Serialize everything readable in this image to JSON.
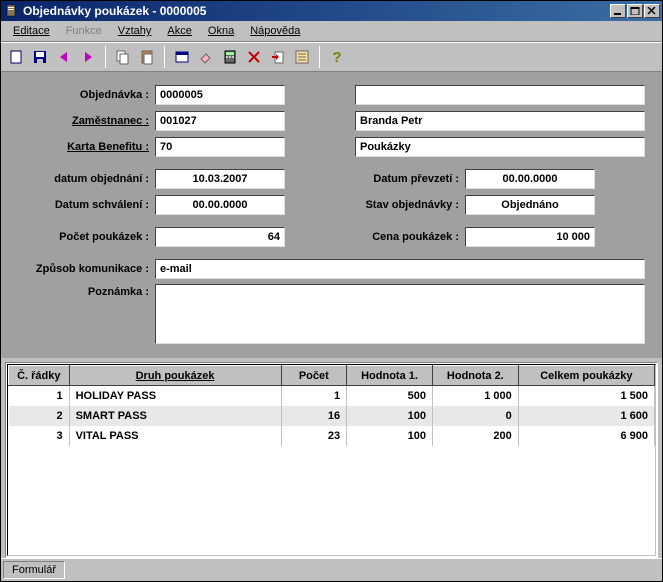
{
  "window": {
    "title": "Objednávky poukázek - 0000005"
  },
  "menu": {
    "editace": "Editace",
    "funkce": "Funkce",
    "vztahy": "Vztahy",
    "akce": "Akce",
    "okna": "Okna",
    "napoveda": "Nápověda"
  },
  "form": {
    "labels": {
      "objednavka": "Objednávka :",
      "zamestnanec": "Zaměstnanec :",
      "karta_benefitu": "Karta Benefitu :",
      "datum_objednani": "datum objednání :",
      "datum_prevzeti": "Datum převzetí :",
      "datum_schvaleni": "Datum schválení :",
      "stav_objednavky": "Stav objednávky :",
      "pocet_poukazek": "Počet poukázek :",
      "cena_poukazek": "Cena poukázek :",
      "zpusob_komunikace": "Způsob komunikace :",
      "poznamka": "Poznámka :"
    },
    "values": {
      "objednavka": "0000005",
      "objednavka_desc": "",
      "zamestnanec": "001027",
      "zamestnanec_name": "Branda Petr",
      "karta_benefitu": "70",
      "karta_benefitu_name": "Poukázky",
      "datum_objednani": "10.03.2007",
      "datum_prevzeti": "00.00.0000",
      "datum_schvaleni": "00.00.0000",
      "stav_objednavky": "Objednáno",
      "pocet_poukazek": "64",
      "cena_poukazek": "10 000",
      "zpusob_komunikace": "e-mail",
      "poznamka": ""
    }
  },
  "grid": {
    "headers": {
      "c_radky": "Č. řádky",
      "druh": "Druh poukázek",
      "pocet": "Počet",
      "hodnota1": "Hodnota 1.",
      "hodnota2": "Hodnota 2.",
      "celkem": "Celkem poukázky"
    },
    "rows": [
      {
        "num": "1",
        "druh": "HOLIDAY PASS",
        "pocet": "1",
        "h1": "500",
        "h2": "1 000",
        "celkem": "1 500"
      },
      {
        "num": "2",
        "druh": "SMART PASS",
        "pocet": "16",
        "h1": "100",
        "h2": "0",
        "celkem": "1 600"
      },
      {
        "num": "3",
        "druh": "VITAL PASS",
        "pocet": "23",
        "h1": "100",
        "h2": "200",
        "celkem": "6 900"
      }
    ]
  },
  "status": {
    "formular": "Formulář"
  }
}
